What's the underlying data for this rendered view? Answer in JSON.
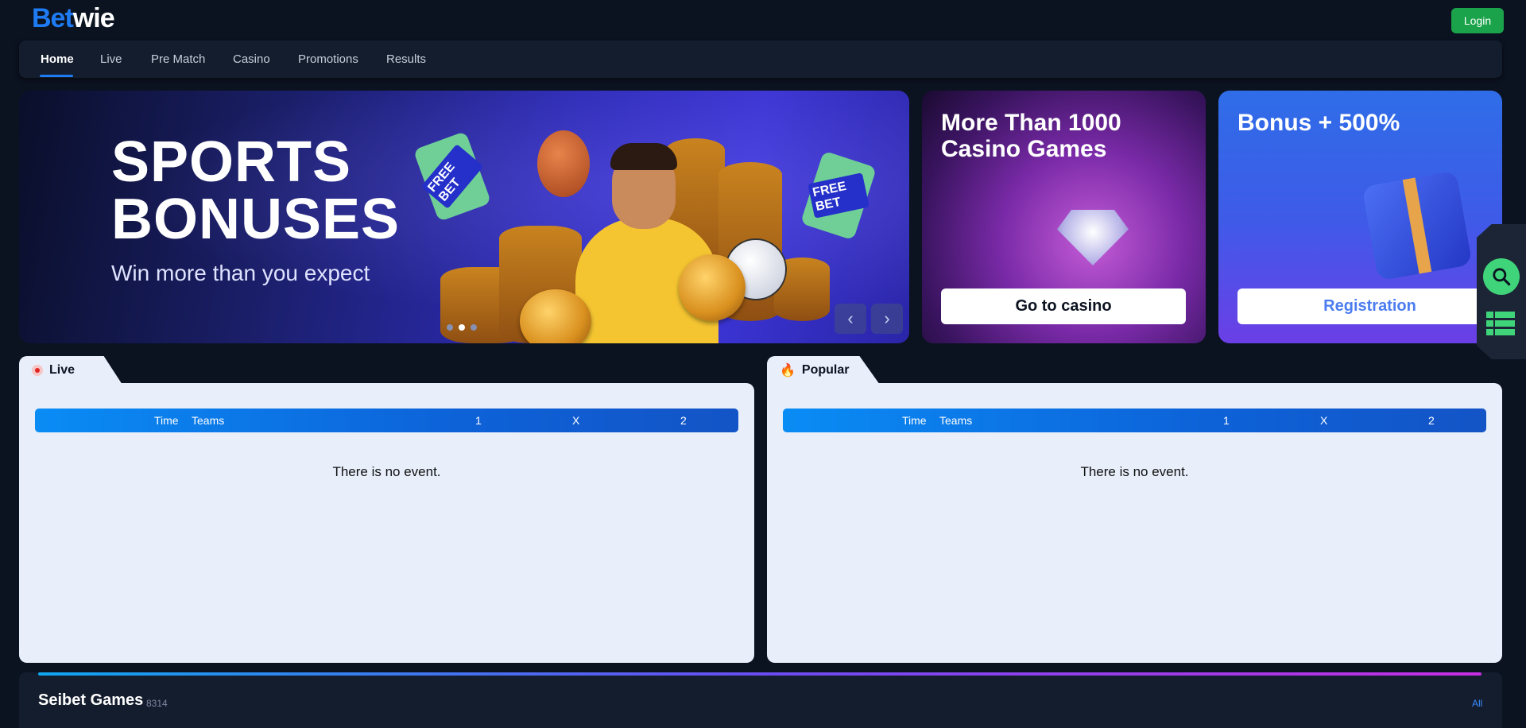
{
  "brand": {
    "logo_part1": "Bet",
    "logo_part2": "wie"
  },
  "header": {
    "login_label": "Login"
  },
  "nav": {
    "items": [
      {
        "label": "Home",
        "active": true
      },
      {
        "label": "Live"
      },
      {
        "label": "Pre Match"
      },
      {
        "label": "Casino"
      },
      {
        "label": "Promotions"
      },
      {
        "label": "Results"
      }
    ]
  },
  "hero": {
    "title_line1": "SPORTS",
    "title_line2": "BONUSES",
    "subtitle": "Win more than you expect",
    "ticket_text": "FREE BET",
    "active_slide": 2,
    "slide_count": 3
  },
  "promos": {
    "casino": {
      "title_line1": "More Than 1000",
      "title_line2": "Casino Games",
      "button": "Go to casino"
    },
    "bonus": {
      "title": "Bonus + 500%",
      "button": "Registration"
    }
  },
  "panels": {
    "live": {
      "tab": "Live",
      "columns": {
        "time": "Time",
        "teams": "Teams",
        "one": "1",
        "x": "X",
        "two": "2"
      },
      "empty": "There is no event."
    },
    "popular": {
      "tab": "Popular",
      "columns": {
        "time": "Time",
        "teams": "Teams",
        "one": "1",
        "x": "X",
        "two": "2"
      },
      "empty": "There is no event."
    }
  },
  "games": {
    "title": "Seibet Games",
    "count": "8314",
    "all_label": "All"
  },
  "colors": {
    "accent": "#1e7bf2",
    "login": "#1aa34a",
    "search": "#3fd37a",
    "background": "#0b1220"
  },
  "icons": {
    "search": "search-icon",
    "list": "list-grid-icon",
    "live": "live-dot-icon",
    "popular": "fire-icon"
  }
}
